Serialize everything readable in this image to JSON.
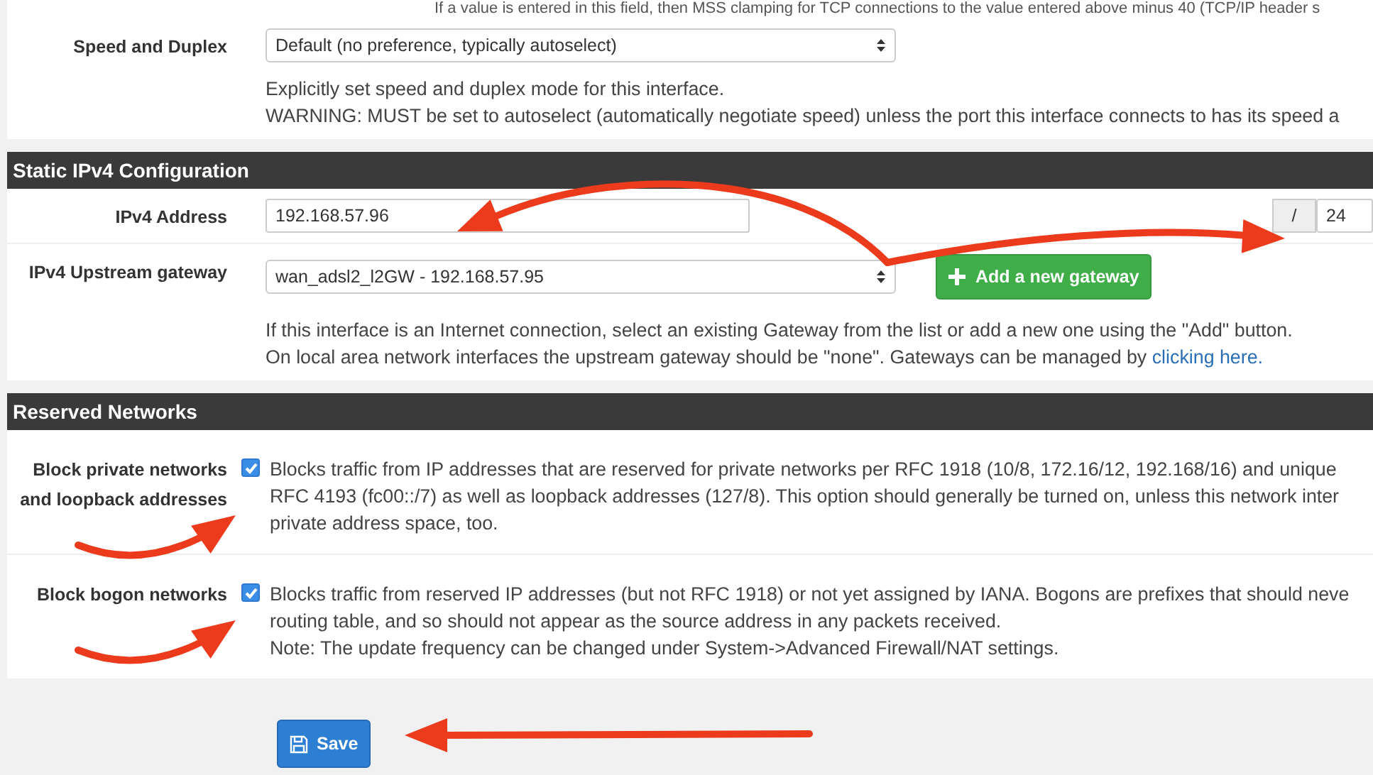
{
  "top_note": "If a value is entered in this field, then MSS clamping for TCP connections to the value entered above minus 40 (TCP/IP header s",
  "sections": [
    {
      "rows": [
        {
          "kind": "select",
          "label": "Speed and Duplex",
          "value": "Default (no preference, typically autoselect)",
          "help": [
            {
              "text": "Explicitly set speed and duplex mode for this interface."
            },
            {
              "text": "WARNING: MUST be set to autoselect (automatically negotiate speed) unless the port this interface connects to has its speed a"
            }
          ]
        }
      ]
    },
    {
      "title": "Static IPv4 Configuration",
      "rows": [
        {
          "kind": "address",
          "label": "IPv4 Address",
          "value": "192.168.57.96",
          "separator": "/",
          "mask": "24"
        },
        {
          "kind": "gateway",
          "label": "IPv4 Upstream gateway",
          "value": "wan_adsl2_l2GW - 192.168.57.95",
          "button": "Add a new gateway",
          "help": [
            {
              "text": "If this interface is an Internet connection, select an existing Gateway from the list or add a new one using the \"Add\" button."
            },
            {
              "text": "On local area network interfaces the upstream gateway should be \"none\". Gateways can be managed by ",
              "link": "clicking here."
            }
          ]
        }
      ]
    },
    {
      "title": "Reserved Networks",
      "rows": [
        {
          "kind": "checkbox",
          "label": "Block private networks and loopback addresses",
          "checked": true,
          "help": [
            {
              "text": "Blocks traffic from IP addresses that are reserved for private networks per RFC 1918 (10/8, 172.16/12, 192.168/16) and unique"
            },
            {
              "text": "RFC 4193 (fc00::/7) as well as loopback addresses (127/8). This option should generally be turned on, unless this network inter"
            },
            {
              "text": "private address space, too."
            }
          ]
        },
        {
          "kind": "checkbox",
          "label": "Block bogon networks",
          "checked": true,
          "help": [
            {
              "text": "Blocks traffic from reserved IP addresses (but not RFC 1918) or not yet assigned by IANA. Bogons are prefixes that should neve"
            },
            {
              "text": "routing table, and so should not appear as the source address in any packets received."
            },
            {
              "text": "Note: The update frequency can be changed under System->Advanced Firewall/NAT settings."
            }
          ]
        }
      ]
    }
  ],
  "save": {
    "label": "Save"
  }
}
